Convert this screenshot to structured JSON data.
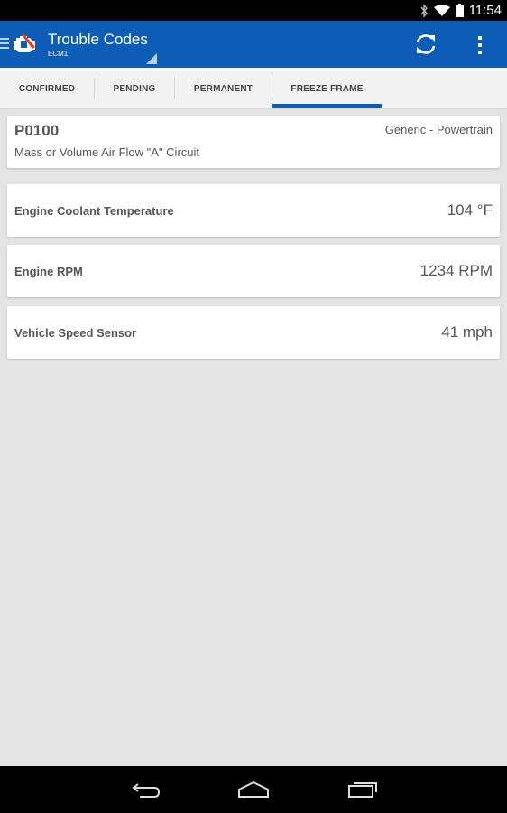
{
  "status_bar": {
    "time": "11:54",
    "icons": [
      "bluetooth-icon",
      "wifi-icon",
      "battery-icon"
    ]
  },
  "action_bar": {
    "title": "Trouble Codes",
    "subtitle": "ECM1",
    "color": "#0d5cb6",
    "icons": [
      "nav-drawer-icon",
      "engine-check-icon",
      "refresh-icon",
      "overflow-menu-icon"
    ]
  },
  "tabs": [
    {
      "label": "CONFIRMED",
      "selected": false
    },
    {
      "label": "PENDING",
      "selected": false
    },
    {
      "label": "PERMANENT",
      "selected": false
    },
    {
      "label": "FREEZE FRAME",
      "selected": true
    }
  ],
  "dtc": {
    "code": "P0100",
    "category": "Generic - Powertrain",
    "description": "Mass or Volume Air Flow \"A\" Circuit"
  },
  "freeze_frame": [
    {
      "label": "Engine Coolant Temperature",
      "value": "104 °F"
    },
    {
      "label": "Engine RPM",
      "value": "1234 RPM"
    },
    {
      "label": "Vehicle Speed Sensor",
      "value": "41 mph"
    }
  ],
  "nav_bar": {
    "icons": [
      "back-icon",
      "home-icon",
      "recent-apps-icon"
    ]
  }
}
